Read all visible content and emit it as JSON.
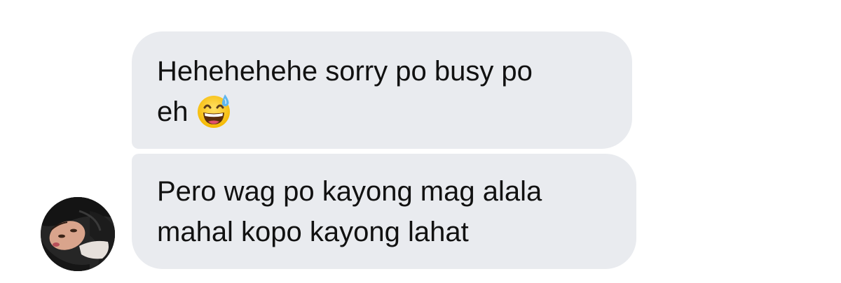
{
  "messages": [
    {
      "lines": [
        "Hehehehehe sorry po busy po",
        "eh"
      ],
      "emoji": "grinning-face-with-sweat-icon"
    },
    {
      "lines": [
        "Pero wag po kayong mag alala",
        "mahal kopo kayong lahat"
      ]
    }
  ],
  "colors": {
    "bubble_background": "#e9ebef",
    "text": "#111111",
    "page_background": "#ffffff"
  }
}
